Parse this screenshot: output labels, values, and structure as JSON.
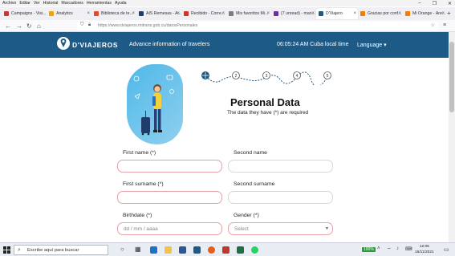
{
  "browser": {
    "menu": [
      "Archivo",
      "Editar",
      "Ver",
      "Historial",
      "Marcadores",
      "Herramientas",
      "Ayuda"
    ],
    "tabs": [
      {
        "label": "Campaigns - Visi...",
        "color": "#cc3333"
      },
      {
        "label": "Analytics",
        "color": "#f4a300"
      },
      {
        "label": "Biblioteca de te...",
        "color": "#e54b2b"
      },
      {
        "label": "AIS Remesas - A...",
        "color": "#1d3d6b"
      },
      {
        "label": "Recibido - Corre...",
        "color": "#d93025"
      },
      {
        "label": "Mis favoritos Mi...",
        "color": "#7d7d7d"
      },
      {
        "label": "(7 unread) - man...",
        "color": "#6b2fa0"
      },
      {
        "label": "D'Viajero",
        "color": "#1e5a86"
      },
      {
        "label": "Gracias por conf...",
        "color": "#f57c00"
      },
      {
        "label": "Mi Orange - Áre...",
        "color": "#ff7900"
      }
    ],
    "url": "https://www.dviajeros.mitrans.gob.cu/datosPersonales"
  },
  "header": {
    "logo": "D'VIAJEROS",
    "tagline": "Advance information of travelers",
    "clock": "06:05:24 AM Cuba local time",
    "language": "Language ▾"
  },
  "steps": [
    "2",
    "3",
    "4",
    "5"
  ],
  "form": {
    "title": "Personal Data",
    "subtitle": "The data they have (*) are required",
    "first_name_label": "First name (*)",
    "second_name_label": "Second name",
    "first_surname_label": "First surname (*)",
    "second_surname_label": "Second surname",
    "birthdate_label": "Birthdate (*)",
    "birthdate_placeholder": "dd / mm / aaaa",
    "gender_label": "Gender (*)",
    "gender_value": "Select"
  },
  "taskbar": {
    "search_placeholder": "Escribe aquí para buscar",
    "battery": "100%",
    "time": "12:05",
    "date": "16/11/2021"
  }
}
